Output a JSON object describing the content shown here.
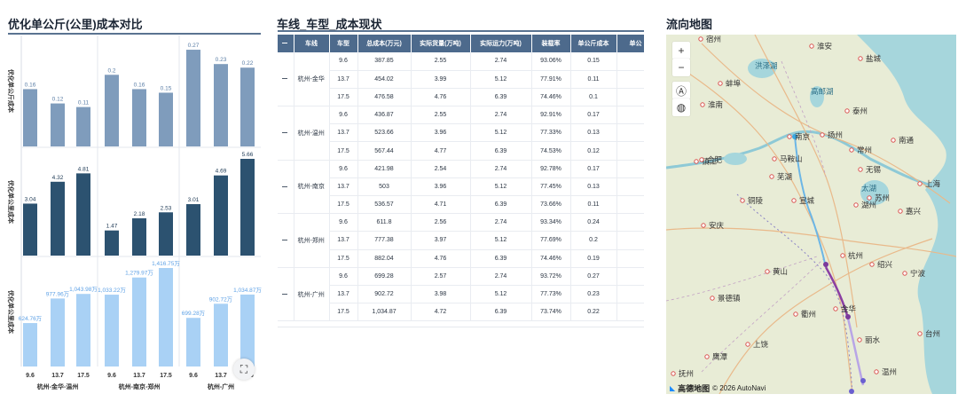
{
  "panels": {
    "left_title": "优化单公斤(公里)成本对比",
    "table_title": "车线_车型_成本现状",
    "map_title": "流向地图"
  },
  "colors": {
    "row1": "#7f9cbc",
    "row2": "#2c5270",
    "row3": "#a9d1f5",
    "row1_label": "#5b7ea6",
    "row2_label": "#1e3a55",
    "row3_label": "#5fa2e6",
    "title_rule": "#5a7391",
    "table_header": "#4d6a8c"
  },
  "chart_data": {
    "type": "bar",
    "row_labels": [
      "优化单公斤成本",
      "优化单公里成本",
      "优化单公里成本"
    ],
    "groups": [
      "杭州-金华-温州",
      "杭州-南京-郑州",
      "杭州-广州"
    ],
    "categories": [
      "9.6",
      "13.7",
      "17.5"
    ],
    "series": [
      {
        "values": [
          [
            0.16,
            0.12,
            0.11
          ],
          [
            0.2,
            0.16,
            0.15
          ],
          [
            0.27,
            0.23,
            0.22
          ]
        ],
        "labels": [
          [
            "0.16",
            "0.12",
            "0.11"
          ],
          [
            "0.2",
            "0.16",
            "0.15"
          ],
          [
            "0.27",
            "0.23",
            "0.22"
          ]
        ],
        "ylim": [
          0,
          0.28
        ]
      },
      {
        "values": [
          [
            3.04,
            4.32,
            4.81
          ],
          [
            1.47,
            2.18,
            2.53
          ],
          [
            3.01,
            4.69,
            5.66
          ]
        ],
        "labels": [
          [
            "3.04",
            "4.32",
            "4.81"
          ],
          [
            "1.47",
            "2.18",
            "2.53"
          ],
          [
            "3.01",
            "4.69",
            "5.66"
          ]
        ],
        "ylim": [
          0,
          5.66
        ]
      },
      {
        "values": [
          [
            624.76,
            977.96,
            1043.98
          ],
          [
            1033.22,
            1279.97,
            1416.75
          ],
          [
            699.28,
            902.72,
            1034.87
          ]
        ],
        "labels": [
          [
            "624.76万",
            "977.96万",
            "1,043.98万"
          ],
          [
            "1,033.22万",
            "1,279.97万",
            "1,416.75万"
          ],
          [
            "699.28万",
            "902.72万",
            "1,034.87万"
          ]
        ],
        "ylim": [
          0,
          1416.75
        ]
      }
    ]
  },
  "table": {
    "headers": [
      "车线",
      "车型",
      "总成本(万元)",
      "实际货量(万吨)",
      "实际运力(万吨)",
      "装载率",
      "单公斤成本",
      "单公"
    ],
    "groups": [
      {
        "name": "杭州-金华",
        "rows": [
          [
            "9.6",
            "387.85",
            "2.55",
            "2.74",
            "93.06%",
            "0.15"
          ],
          [
            "13.7",
            "454.02",
            "3.99",
            "5.12",
            "77.91%",
            "0.11"
          ],
          [
            "17.5",
            "476.58",
            "4.76",
            "6.39",
            "74.46%",
            "0.1"
          ]
        ]
      },
      {
        "name": "杭州-温州",
        "rows": [
          [
            "9.6",
            "436.87",
            "2.55",
            "2.74",
            "92.91%",
            "0.17"
          ],
          [
            "13.7",
            "523.66",
            "3.96",
            "5.12",
            "77.33%",
            "0.13"
          ],
          [
            "17.5",
            "567.44",
            "4.77",
            "6.39",
            "74.53%",
            "0.12"
          ]
        ]
      },
      {
        "name": "杭州-南京",
        "rows": [
          [
            "9.6",
            "421.98",
            "2.54",
            "2.74",
            "92.78%",
            "0.17"
          ],
          [
            "13.7",
            "503",
            "3.96",
            "5.12",
            "77.45%",
            "0.13"
          ],
          [
            "17.5",
            "536.57",
            "4.71",
            "6.39",
            "73.66%",
            "0.11"
          ]
        ]
      },
      {
        "name": "杭州-郑州",
        "rows": [
          [
            "9.6",
            "611.8",
            "2.56",
            "2.74",
            "93.34%",
            "0.24"
          ],
          [
            "13.7",
            "777.38",
            "3.97",
            "5.12",
            "77.69%",
            "0.2"
          ],
          [
            "17.5",
            "882.04",
            "4.76",
            "6.39",
            "74.46%",
            "0.19"
          ]
        ]
      },
      {
        "name": "杭州-广州",
        "rows": [
          [
            "9.6",
            "699.28",
            "2.57",
            "2.74",
            "93.72%",
            "0.27"
          ],
          [
            "13.7",
            "902.72",
            "3.98",
            "5.12",
            "77.73%",
            "0.23"
          ],
          [
            "17.5",
            "1,034.87",
            "4.72",
            "6.39",
            "73.74%",
            "0.22"
          ]
        ]
      }
    ]
  },
  "map": {
    "zoom_in": "+",
    "zoom_out": "−",
    "locate_icon": "compass-icon",
    "layer_icon": "palette-icon",
    "attribution_logo": "高德地图",
    "attribution_text": "© 2026 AutoNavi",
    "cities": [
      "宿州",
      "淮安",
      "盐城",
      "蚌埠",
      "淮南",
      "泰州",
      "南京",
      "扬州",
      "镇江",
      "南通",
      "合肥",
      "马鞍山",
      "常州",
      "无锡",
      "芜湖",
      "苏州",
      "上海",
      "铜陵",
      "宣城",
      "湖州",
      "嘉兴",
      "安庆",
      "杭州",
      "黄山",
      "绍兴",
      "宁波",
      "景德镇",
      "衢州",
      "金华",
      "台州",
      "上饶",
      "丽水",
      "温州",
      "鹰潭",
      "抚州",
      "洪泽湖",
      "高邮湖",
      "太湖"
    ],
    "lakes": [
      "洪泽湖",
      "高邮湖",
      "太湖"
    ]
  },
  "fab_icon": "expand-icon"
}
